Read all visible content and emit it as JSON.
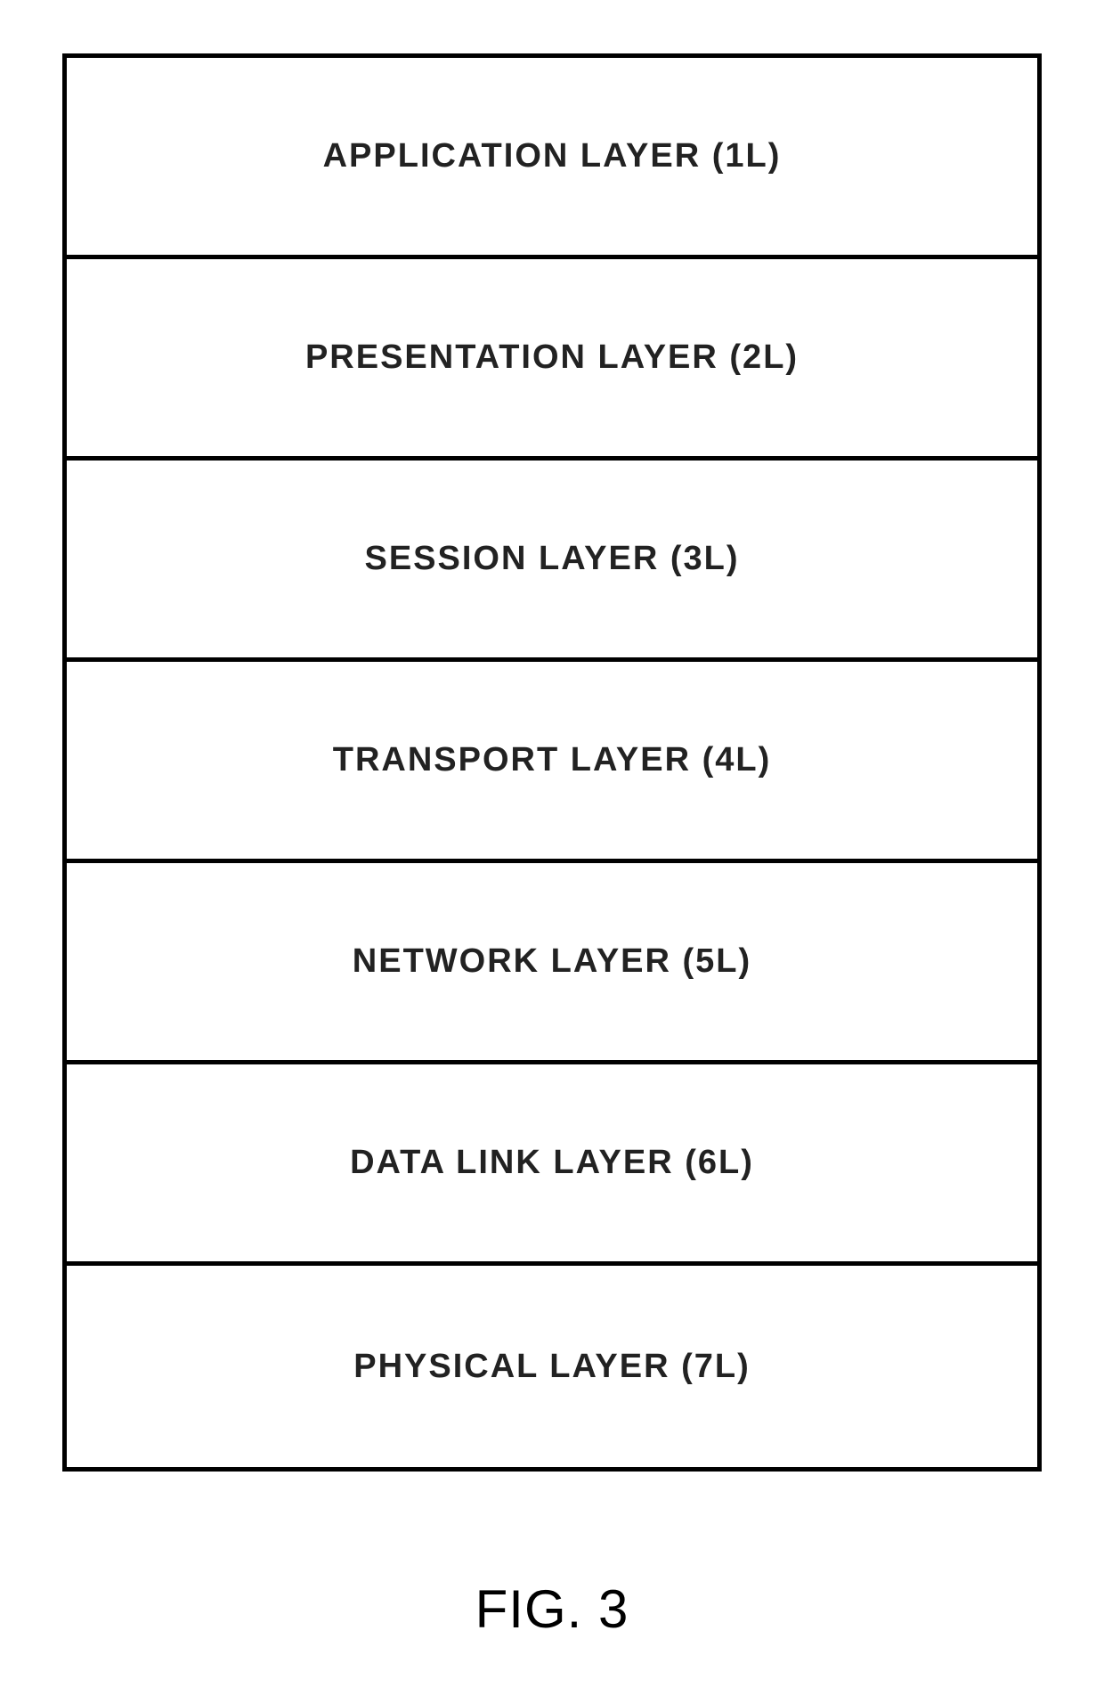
{
  "layers": [
    {
      "label": "APPLICATION LAYER (1L)"
    },
    {
      "label": "PRESENTATION LAYER (2L)"
    },
    {
      "label": "SESSION LAYER (3L)"
    },
    {
      "label": "TRANSPORT LAYER (4L)"
    },
    {
      "label": "NETWORK LAYER (5L)"
    },
    {
      "label": "DATA LINK LAYER (6L)"
    },
    {
      "label": "PHYSICAL LAYER (7L)"
    }
  ],
  "caption": "FIG. 3"
}
